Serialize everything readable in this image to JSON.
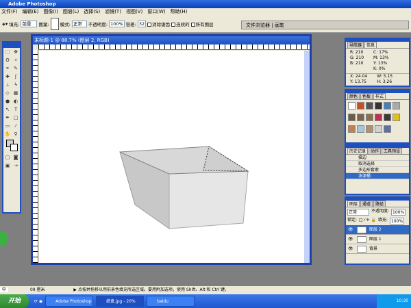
{
  "app": {
    "title": "Adobe Photoshop"
  },
  "menu": [
    "文件(F)",
    "编辑(E)",
    "图像(I)",
    "图层(L)",
    "选择(S)",
    "滤镜(T)",
    "视图(V)",
    "窗口(W)",
    "帮助(H)"
  ],
  "options": {
    "fill_label": "填充:",
    "fill_value": "前景",
    "pattern_label": "图案:",
    "mode_label": "模式:",
    "mode_value": "正常",
    "opacity_label": "不透明度:",
    "opacity_value": "100%",
    "tolerance_label": "容差:",
    "tolerance_value": "32",
    "antialias": "消除锯齿",
    "contiguous": "连续的",
    "all_layers": "所有图层"
  },
  "palette_well": [
    "文件浏览器",
    "画笔"
  ],
  "document": {
    "title": "未标题-1 @ 88.7% (图层 2, RGB)"
  },
  "info_panel": {
    "tabs": [
      "导航器",
      "信息"
    ],
    "R": "210",
    "G": "210",
    "B": "210",
    "C": "17%",
    "M": "13%",
    "Y": "13%",
    "K": "0%",
    "X": "24.04",
    "Y_pos": "13.75",
    "W": "5.15",
    "H": "3.26"
  },
  "swatch_panel": {
    "tabs": [
      "颜色",
      "色板",
      "样式"
    ]
  },
  "history_panel": {
    "tabs": [
      "历史记录",
      "动作",
      "工具预设"
    ],
    "items": [
      "描边",
      "取消选择",
      "多边形套索",
      "油漆桶"
    ]
  },
  "layers_panel": {
    "tabs": [
      "图层",
      "通道",
      "路径"
    ],
    "mode": "正常",
    "opacity_label": "不透明度:",
    "opacity": "100%",
    "lock_label": "锁定:",
    "fill_label": "填充:",
    "fill": "100%",
    "layers": [
      "图层 2",
      "图层 1",
      "背景"
    ]
  },
  "status": {
    "ime": "中",
    "zoom": "09 厘米",
    "hint": "点按并拖移以用前景色填充所选区域。要用附加选项，使用 Shift、Alt 和 Ctrl 键。"
  },
  "taskbar": {
    "start": "开始",
    "tasks": [
      "Adobe Photoshop",
      "纸盒.jpg - 20%",
      "baidu"
    ],
    "clock": "10:30"
  },
  "colors": {
    "selection": "#316ac5",
    "window_frame": "#1d4fc0"
  }
}
